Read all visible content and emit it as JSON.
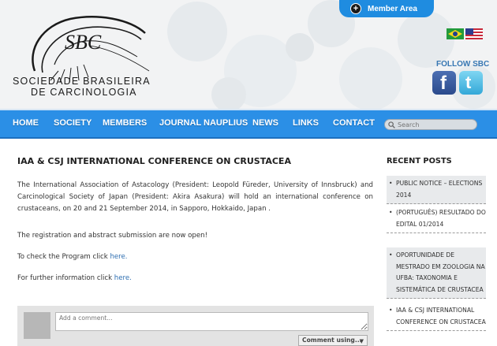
{
  "header": {
    "member_area": "Member Area",
    "logo_line1": "SOCIEDADE BRASILEIRA",
    "logo_line2": "DE CARCINOLOGIA",
    "logo_mark": "SBC",
    "follow": "FOLLOW SBC",
    "facebook_glyph": "f",
    "twitter_glyph": "t"
  },
  "nav": {
    "items": [
      "HOME",
      "SOCIETY",
      "MEMBERS",
      "JOURNAL NAUPLIUS",
      "NEWS",
      "LINKS",
      "CONTACT"
    ],
    "search_placeholder": "Search"
  },
  "post": {
    "title": "IAA & CSJ INTERNATIONAL CONFERENCE ON CRUSTACEA",
    "para1": "The International Association of Astacology (President: Leopold Füreder, University of Innsbruck) and Carcinological Society of Japan (President: Akira Asakura) will hold an international conference on crustaceans, on 20 and 21 September 2014, in Sapporo, Hokkaido, Japan .",
    "para2": "The registration and abstract submission are now open!",
    "para3_text": "To check the Program click ",
    "para3_link": "here.",
    "para4_text": "For further information click ",
    "para4_link": "here."
  },
  "comments": {
    "placeholder": "Add a comment...",
    "button": "Comment using...",
    "caret": "▼"
  },
  "sidebar": {
    "title": "RECENT POSTS",
    "posts": [
      "PUBLIC NOTICE – ELECTIONS 2014",
      "(PORTUGUÊS) RESULTADO DO EDITAL 01/2014",
      "OPORTUNIDADE DE MESTRADO EM ZOOLOGIA NA UFBA: TAXONOMIA E SISTEMÁTICA DE CRUSTACEA",
      "IAA & CSJ INTERNATIONAL CONFERENCE ON CRUSTACEA"
    ]
  },
  "colors": {
    "nav_blue": "#2b8fe6",
    "member_tab": "#1f8ce0",
    "link": "#2f6fb1"
  }
}
